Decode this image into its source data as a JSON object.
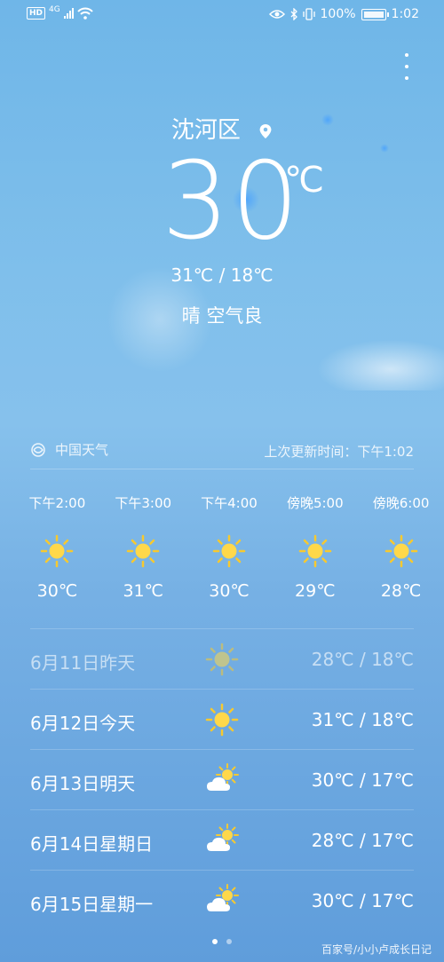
{
  "status_bar": {
    "hd": "HD",
    "network": "4G",
    "battery": "100%",
    "time": "1:02"
  },
  "location": "沈河区",
  "current": {
    "temp": "30",
    "unit": "℃",
    "range": "31℃ / 18℃",
    "condition": "晴  空气良"
  },
  "source": {
    "name": "中国天气",
    "updated": "上次更新时间：下午1:02"
  },
  "hourly": [
    {
      "time": "下午2:00",
      "temp": "30℃",
      "icon": "sun-icon"
    },
    {
      "time": "下午3:00",
      "temp": "31℃",
      "icon": "sun-icon"
    },
    {
      "time": "下午4:00",
      "temp": "30℃",
      "icon": "sun-icon"
    },
    {
      "time": "傍晚5:00",
      "temp": "29℃",
      "icon": "sun-icon"
    },
    {
      "time": "傍晚6:00",
      "temp": "28℃",
      "icon": "sun-icon"
    }
  ],
  "daily": [
    {
      "date": "6月11日昨天",
      "range": "28℃ / 18℃",
      "icon": "sun-icon"
    },
    {
      "date": "6月12日今天",
      "range": "31℃ / 18℃",
      "icon": "sun-icon"
    },
    {
      "date": "6月13日明天",
      "range": "30℃ / 17℃",
      "icon": "partly-cloudy-icon"
    },
    {
      "date": "6月14日星期日",
      "range": "28℃ / 17℃",
      "icon": "partly-cloudy-icon"
    },
    {
      "date": "6月15日星期一",
      "range": "30℃ / 17℃",
      "icon": "partly-cloudy-icon"
    }
  ],
  "watermark": "百家号/小小卢成长日记",
  "colors": {
    "sun": "#ffd84a",
    "sun_ray": "#f6c930"
  }
}
